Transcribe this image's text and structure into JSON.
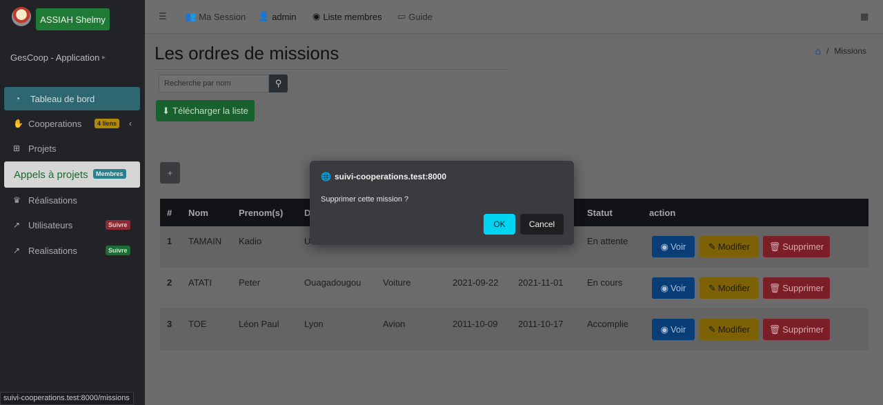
{
  "sidebar": {
    "user_button": "ASSIAH Shelmy",
    "app_name": "GesCoop - Application",
    "items": [
      {
        "label": "Tableau de bord",
        "icon": "dashboard-icon"
      },
      {
        "label": "Cooperations",
        "badge": "4 liens",
        "icon": "handshake-icon"
      },
      {
        "label": "Projets",
        "icon": "sitemap-icon"
      },
      {
        "label": "Appels à projets",
        "badge": "Membres"
      },
      {
        "label": "Réalisations",
        "icon": "trophy-icon"
      },
      {
        "label": "Utilisateurs",
        "badge": "Suivre",
        "icon": "chart-icon"
      },
      {
        "label": "Realisations",
        "badge": "Suivre",
        "icon": "chart-icon"
      }
    ]
  },
  "topbar": {
    "session": "Ma Session",
    "admin": "admin",
    "members": "Liste membres",
    "guide": "Guide"
  },
  "page": {
    "title": "Les ordres de missions",
    "breadcrumb": "Missions",
    "search_placeholder": "Recherche par nom",
    "download_label": "Télécharger la liste",
    "add_label": "+"
  },
  "table": {
    "headers": [
      "#",
      "Nom",
      "Prenom(s)",
      "D",
      "",
      "",
      "",
      "Statut",
      "action"
    ],
    "rows": [
      {
        "idx": "1",
        "nom": "TAMAIN",
        "prenom": "Kadio",
        "dest": "U",
        "transport": "",
        "debut": "",
        "fin": "",
        "statut": "En attente"
      },
      {
        "idx": "2",
        "nom": "ATATI",
        "prenom": "Peter",
        "dest": "Ouagadougou",
        "transport": "Voiture",
        "debut": "2021-09-22",
        "fin": "2021-11-01",
        "statut": "En cours"
      },
      {
        "idx": "3",
        "nom": "TOE",
        "prenom": "Léon Paul",
        "dest": "Lyon",
        "transport": "Avion",
        "debut": "2011-10-09",
        "fin": "2011-10-17",
        "statut": "Accomplie"
      }
    ],
    "actions": {
      "view": "Voir",
      "edit": "Modifier",
      "delete": "Supprimer"
    }
  },
  "dialog": {
    "origin": "suivi-cooperations.test:8000",
    "message": "Supprimer cette mission ?",
    "ok": "OK",
    "cancel": "Cancel"
  },
  "status_bar": {
    "url": "suivi-cooperations.test:8000/missions"
  },
  "colors": {
    "primary": "#0d6efd",
    "success": "#28a745",
    "warning": "#ffc107",
    "danger": "#dc3545",
    "info": "#17a2b8",
    "dialog_ok": "#00d4f2"
  }
}
